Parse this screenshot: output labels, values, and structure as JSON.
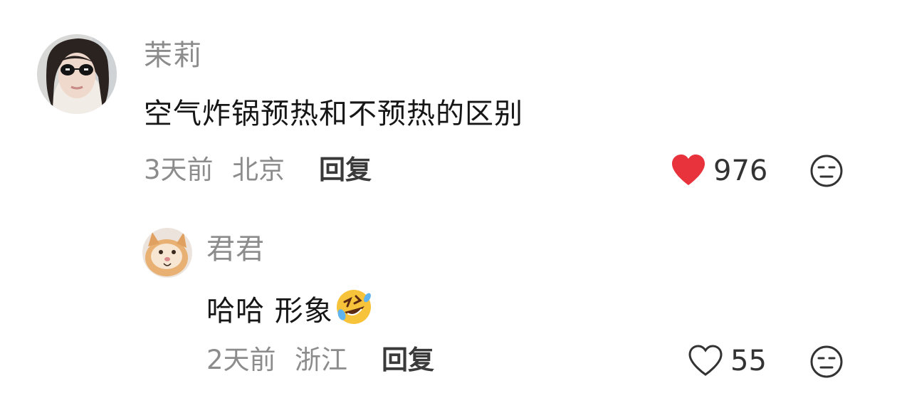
{
  "comments": [
    {
      "avatar": "woman-sunglasses-avatar",
      "username": "茉莉",
      "text": "空气炸锅预热和不预热的区别",
      "time": "3天前",
      "location": "北京",
      "reply_label": "回复",
      "like_count": "976",
      "liked": true,
      "like_color": "#e8323c",
      "dislike_icon": "neutral-face-icon",
      "replies": [
        {
          "avatar": "cat-avatar",
          "username": "君君",
          "text": "哈哈 形象",
          "emoji": "rolling-on-floor-laughing-emoji",
          "time": "2天前",
          "location": "浙江",
          "reply_label": "回复",
          "like_count": "55",
          "liked": false,
          "dislike_icon": "neutral-face-icon"
        }
      ]
    }
  ]
}
